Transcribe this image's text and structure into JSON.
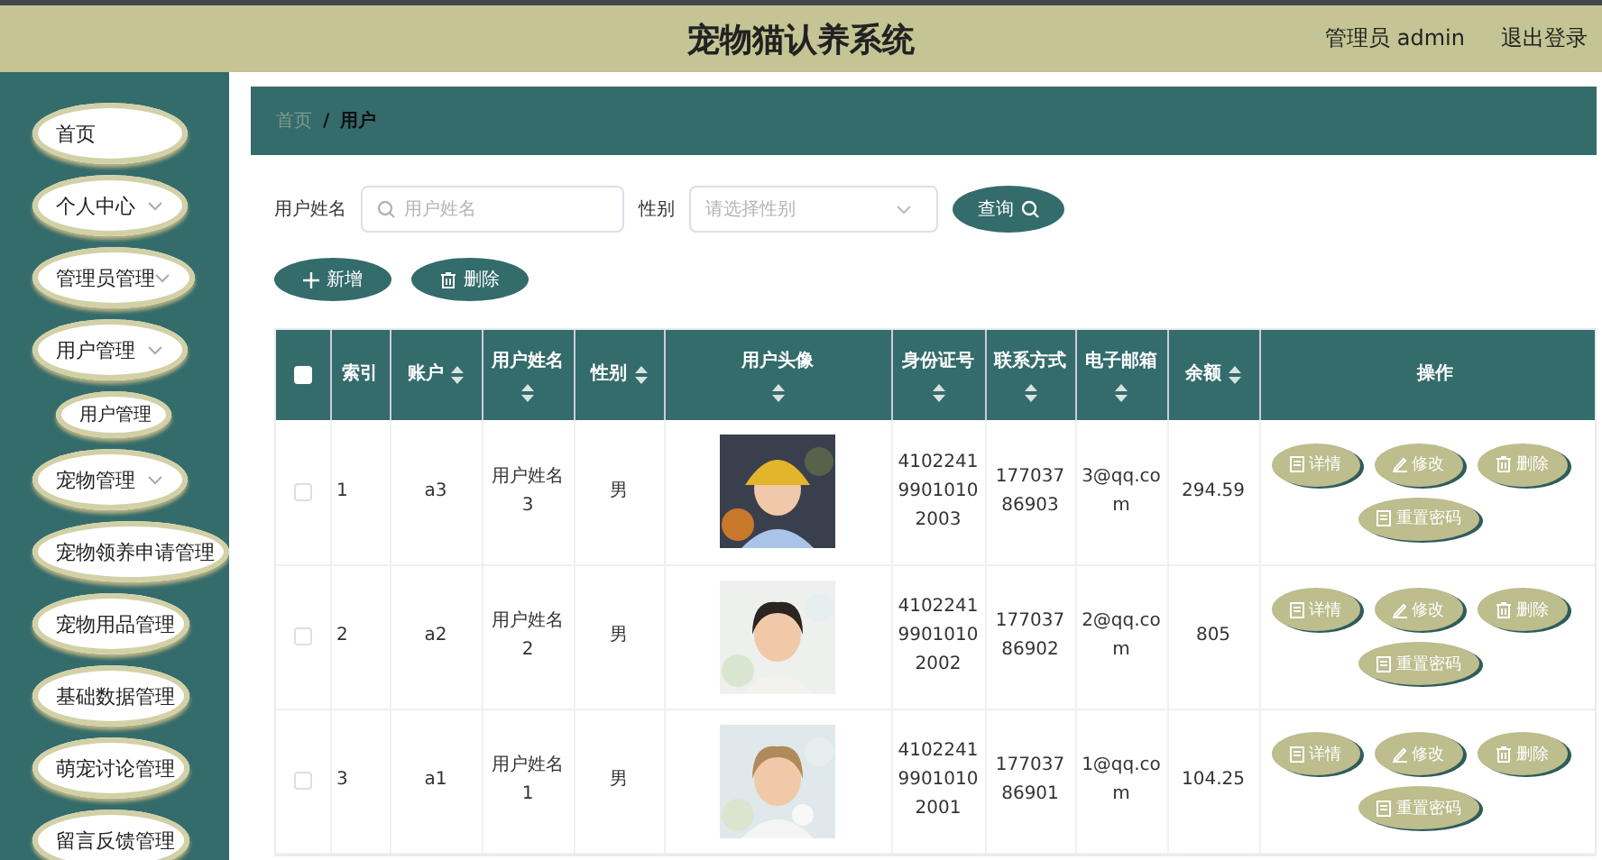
{
  "header": {
    "title": "宠物猫认养系统",
    "user": "管理员 admin",
    "logout": "退出登录"
  },
  "sidebar": {
    "items": [
      {
        "label": "首页",
        "expandable": false
      },
      {
        "label": "个人中心",
        "expandable": true
      },
      {
        "label": "管理员管理",
        "expandable": true
      },
      {
        "label": "用户管理",
        "expandable": true,
        "children": [
          {
            "label": "用户管理"
          }
        ]
      },
      {
        "label": "宠物管理",
        "expandable": true
      },
      {
        "label": "宠物领养申请管理",
        "expandable": false
      },
      {
        "label": "宠物用品管理",
        "expandable": false
      },
      {
        "label": "基础数据管理",
        "expandable": false
      },
      {
        "label": "萌宠讨论管理",
        "expandable": false
      },
      {
        "label": "留言反馈管理",
        "expandable": false
      }
    ]
  },
  "breadcrumb": {
    "items": [
      "首页",
      "用户"
    ],
    "separator": "/"
  },
  "search": {
    "name_label": "用户姓名",
    "name_placeholder": "用户姓名",
    "gender_label": "性别",
    "gender_placeholder": "请选择性别",
    "query_button": "查询"
  },
  "actions": [
    "新增",
    "删除"
  ],
  "table": {
    "select_all": false,
    "columns": [
      {
        "label": "索引",
        "sortable": false
      },
      {
        "label": "账户",
        "sortable": true
      },
      {
        "label": "用户姓名",
        "sortable": true
      },
      {
        "label": "性别",
        "sortable": true
      },
      {
        "label": "用户头像",
        "sortable": true
      },
      {
        "label": "身份证号",
        "sortable": true
      },
      {
        "label": "联系方式",
        "sortable": true
      },
      {
        "label": "电子邮箱",
        "sortable": true
      },
      {
        "label": "余额",
        "sortable": true
      },
      {
        "label": "操作",
        "sortable": false
      }
    ],
    "rows": [
      {
        "checked": false,
        "index": "1",
        "account": "a3",
        "name": "用户姓名3",
        "gender": "男",
        "id_number": "410224199010102003",
        "phone": "17703786903",
        "email": "3@qq.com",
        "balance": "294.59",
        "buttons": [
          "详情",
          "修改",
          "删除",
          "重置密码"
        ]
      },
      {
        "checked": false,
        "index": "2",
        "account": "a2",
        "name": "用户姓名2",
        "gender": "男",
        "id_number": "410224199010102002",
        "phone": "17703786902",
        "email": "2@qq.com",
        "balance": "805",
        "buttons": [
          "详情",
          "修改",
          "删除",
          "重置密码"
        ]
      },
      {
        "checked": false,
        "index": "3",
        "account": "a1",
        "name": "用户姓名1",
        "gender": "男",
        "id_number": "410224199010102001",
        "phone": "17703786901",
        "email": "1@qq.com",
        "balance": "104.25",
        "buttons": [
          "详情",
          "修改",
          "删除",
          "重置密码"
        ]
      }
    ]
  }
}
